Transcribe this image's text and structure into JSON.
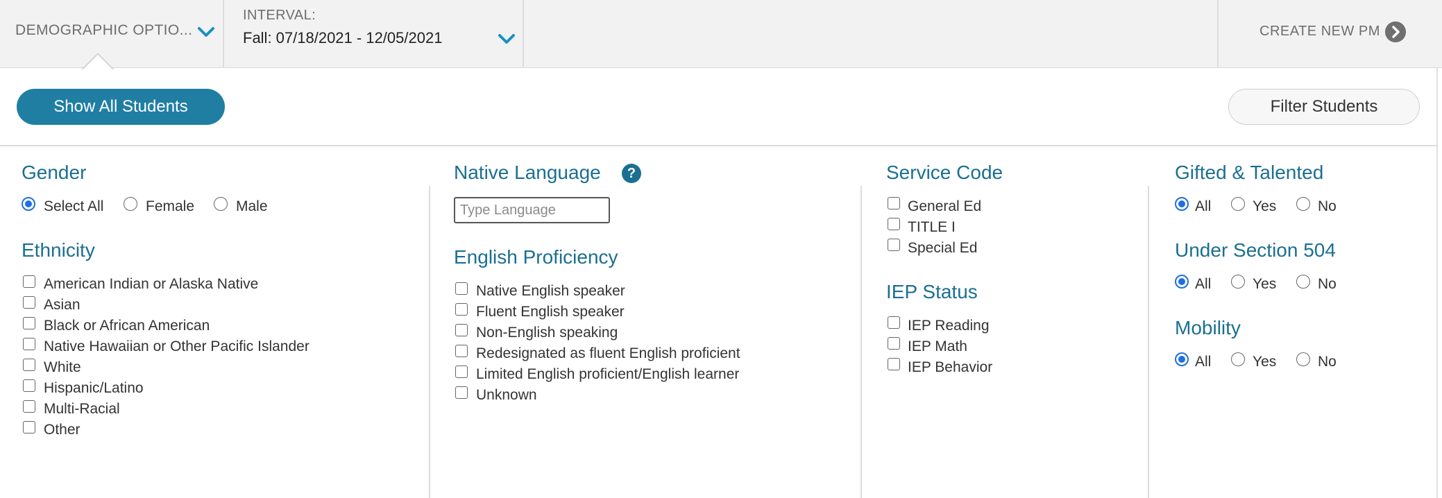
{
  "topbar": {
    "demographic_label": "DEMOGRAPHIC OPTIO...",
    "interval_label": "INTERVAL:",
    "interval_value": "Fall: 07/18/2021 - 12/05/2021",
    "create_label": "CREATE NEW PM"
  },
  "actions": {
    "show_all": "Show All Students",
    "filter": "Filter Students"
  },
  "gender": {
    "title": "Gender",
    "options": [
      "Select All",
      "Female",
      "Male"
    ],
    "selected": "Select All"
  },
  "ethnicity": {
    "title": "Ethnicity",
    "options": [
      "American Indian or Alaska Native",
      "Asian",
      "Black or African American",
      "Native Hawaiian or Other Pacific Islander",
      "White",
      "Hispanic/Latino",
      "Multi-Racial",
      "Other"
    ]
  },
  "native_language": {
    "title": "Native Language",
    "placeholder": "Type Language"
  },
  "english_proficiency": {
    "title": "English Proficiency",
    "options": [
      "Native English speaker",
      "Fluent English speaker",
      "Non-English speaking",
      "Redesignated as fluent English proficient",
      "Limited English proficient/English learner",
      "Unknown"
    ]
  },
  "service_code": {
    "title": "Service Code",
    "options": [
      "General Ed",
      "TITLE I",
      "Special Ed"
    ]
  },
  "iep_status": {
    "title": "IEP Status",
    "options": [
      "IEP Reading",
      "IEP Math",
      "IEP Behavior"
    ]
  },
  "gifted": {
    "title": "Gifted & Talented",
    "options": [
      "All",
      "Yes",
      "No"
    ],
    "selected": "All"
  },
  "section504": {
    "title": "Under Section 504",
    "options": [
      "All",
      "Yes",
      "No"
    ],
    "selected": "All"
  },
  "mobility": {
    "title": "Mobility",
    "options": [
      "All",
      "Yes",
      "No"
    ],
    "selected": "All"
  },
  "colors": {
    "accent": "#1b6f90",
    "button": "#207ea3",
    "radio": "#1f6fe0",
    "topbar": "#f2f2f2"
  }
}
